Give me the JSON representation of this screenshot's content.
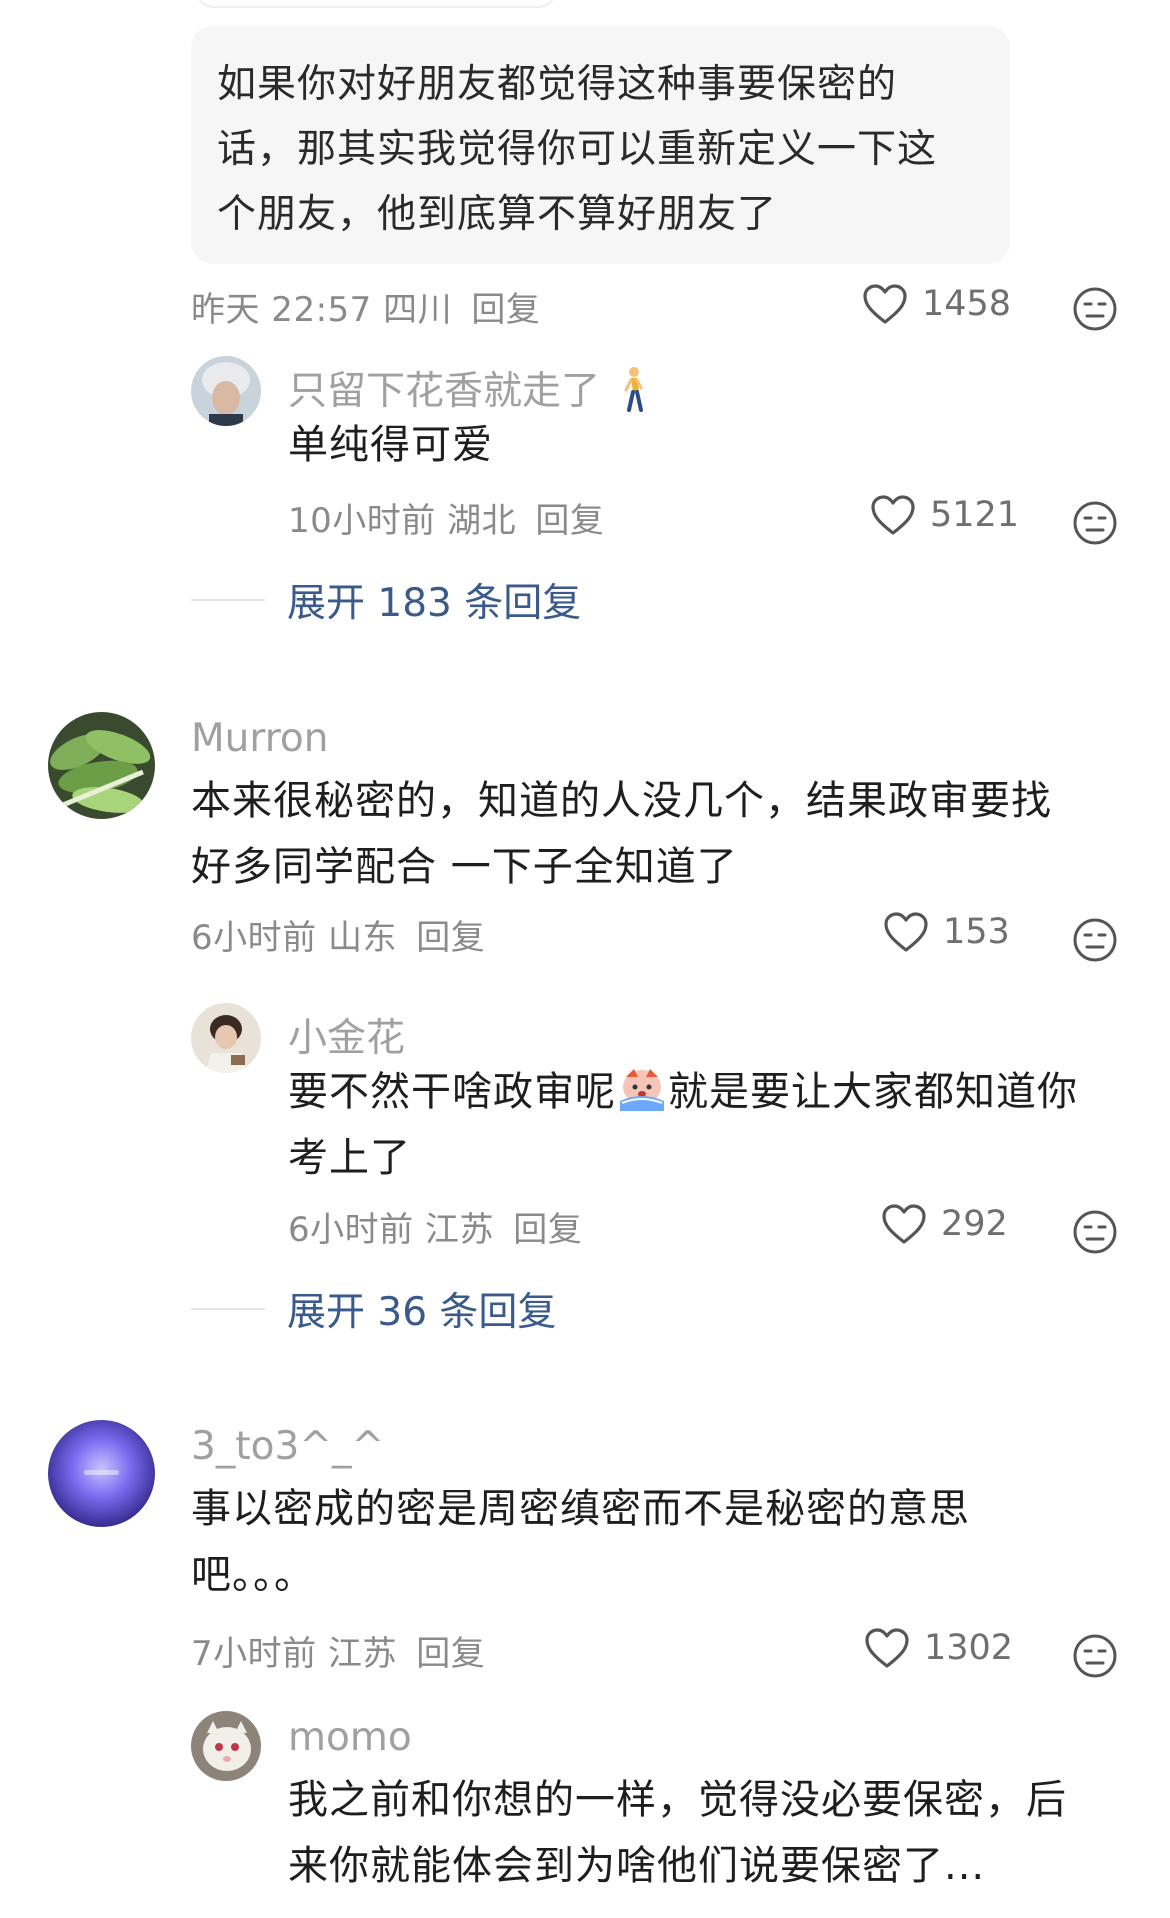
{
  "quote": {
    "line1": "如果你对好朋友都觉得这种事要保密的",
    "line2": "话，那其实我觉得你可以重新定义一下这",
    "line3": "个朋友，他到底算不算好朋友了"
  },
  "quote_meta": {
    "time": "昨天 22:57",
    "region": "四川",
    "reply": "回复",
    "likes": "1458"
  },
  "r1": {
    "username": "只留下花香就走了",
    "text": "单纯得可爱",
    "time": "10小时前",
    "region": "湖北",
    "reply": "回复",
    "likes": "5121"
  },
  "expand1": "展开 183 条回复",
  "c2": {
    "username": "Murron",
    "line1": "本来很秘密的，知道的人没几个，结果政审要找",
    "line2": "好多同学配合 一下子全知道了",
    "time": "6小时前",
    "region": "山东",
    "reply": "回复",
    "likes": "153"
  },
  "r2": {
    "username": "小金花",
    "line1a": "要不然干啥政审呢",
    "line1b": "就是要让大家都知道你",
    "line2": "考上了",
    "time": "6小时前",
    "region": "江苏",
    "reply": "回复",
    "likes": "292"
  },
  "expand2": "展开 36 条回复",
  "c3": {
    "username": "3_to3^_^",
    "line1": "事以密成的密是周密缜密而不是秘密的意思",
    "line2": "吧。。。",
    "time": "7小时前",
    "region": "江苏",
    "reply": "回复",
    "likes": "1302"
  },
  "r3": {
    "username": "momo",
    "line1": "我之前和你想的一样，觉得没必要保密，后",
    "line2": "来你就能体会到为啥他们说要保密了..."
  },
  "colors": {
    "link": "#3a5a8c",
    "meta": "#8a8a8a",
    "username": "#a0a0a0"
  },
  "icons": [
    "heart-icon",
    "dislike-face-icon",
    "walking-person-emoji",
    "crying-face-emoji"
  ]
}
